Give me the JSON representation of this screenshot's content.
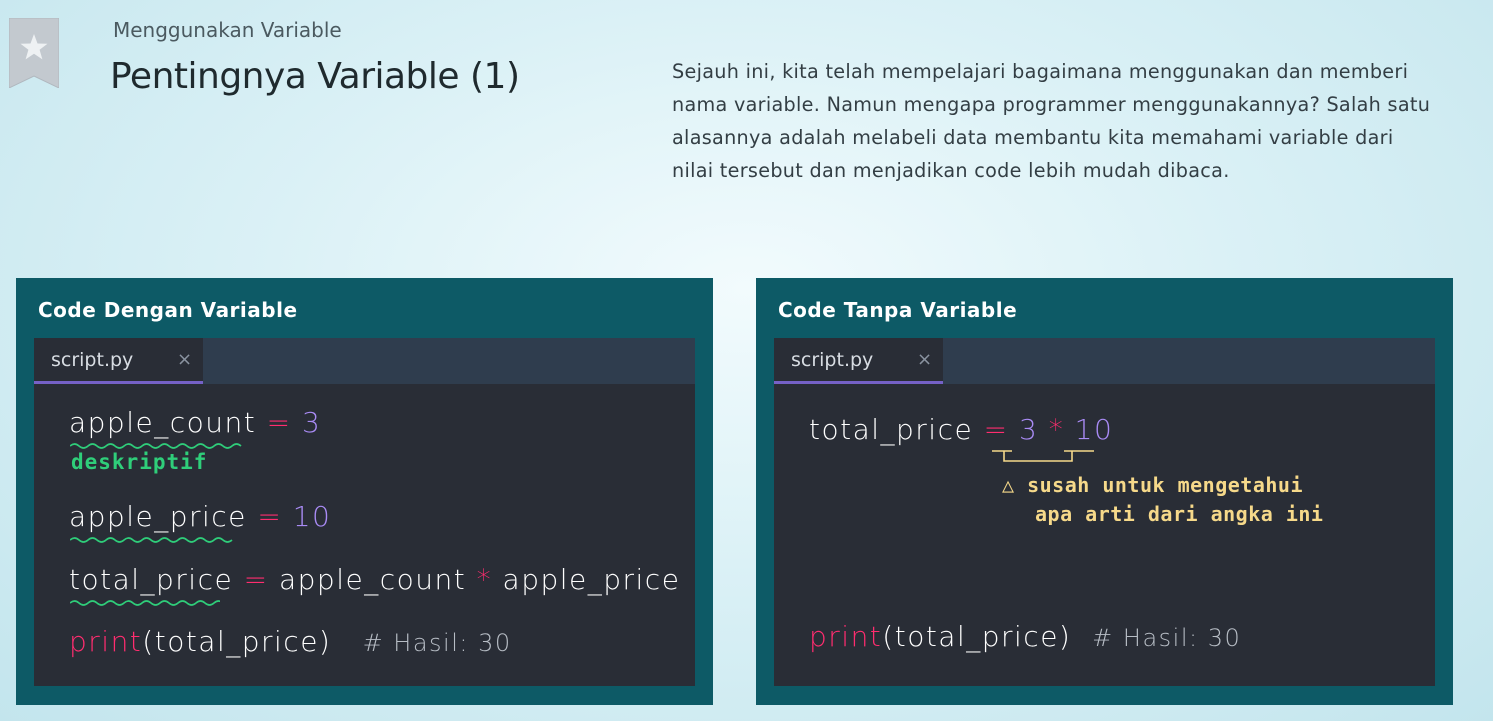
{
  "breadcrumb": "Menggunakan Variable",
  "title": "Pentingnya Variable (1)",
  "intro": "Sejauh ini, kita telah mempelajari bagaimana menggunakan dan memberi nama variable. Namun mengapa programmer menggunakannya? Salah satu alasannya adalah melabeli data membantu kita memahami variable dari nilai tersebut dan menjadikan code lebih mudah dibaca.",
  "colors": {
    "panel_bg": "#0d5a66",
    "editor_bg": "#292d36",
    "tab_accent": "#7561c7",
    "operator": "#ff2d6f",
    "number": "#a98bf5",
    "good_note": "#2fce7a",
    "warn_note": "#f6d98a"
  },
  "icons": {
    "bookmark": "star-bookmark-icon",
    "close": "close-icon",
    "warning": "warning-triangle-icon"
  },
  "left_panel": {
    "title": "Code Dengan Variable",
    "tab": {
      "label": "script.py",
      "close": "×"
    },
    "lines": {
      "l1": {
        "var": "apple_count",
        "op": "=",
        "val": "3"
      },
      "l2": {
        "var": "apple_price",
        "op": "=",
        "val": "10"
      },
      "l3": {
        "var": "total_price",
        "op": "=",
        "a": "apple_count",
        "mul": "*",
        "b": "apple_price"
      },
      "l4": {
        "fn": "print",
        "args": "(total_price)",
        "comment": "# Hasil: 30"
      }
    },
    "note": "deskriptif"
  },
  "right_panel": {
    "title": "Code Tanpa Variable",
    "tab": {
      "label": "script.py",
      "close": "×"
    },
    "lines": {
      "l1": {
        "var": "total_price",
        "op": "=",
        "a": "3",
        "mul": "*",
        "b": "10"
      },
      "l2": {
        "fn": "print",
        "args": "(total_price)",
        "comment": "# Hasil: 30"
      }
    },
    "note_line1": "susah untuk mengetahui",
    "note_line2": "apa arti dari angka ini",
    "note_icon": "△"
  }
}
